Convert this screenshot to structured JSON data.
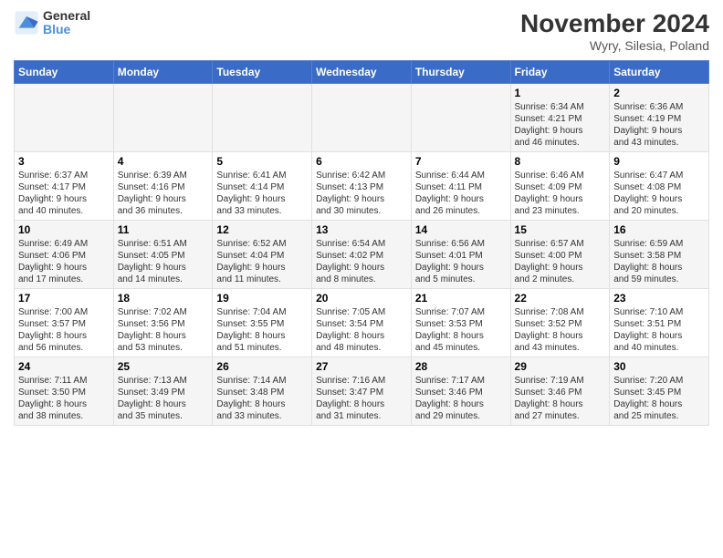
{
  "header": {
    "logo_line1": "General",
    "logo_line2": "Blue",
    "title": "November 2024",
    "subtitle": "Wyry, Silesia, Poland"
  },
  "days_of_week": [
    "Sunday",
    "Monday",
    "Tuesday",
    "Wednesday",
    "Thursday",
    "Friday",
    "Saturday"
  ],
  "weeks": [
    [
      {
        "day": "",
        "info": ""
      },
      {
        "day": "",
        "info": ""
      },
      {
        "day": "",
        "info": ""
      },
      {
        "day": "",
        "info": ""
      },
      {
        "day": "",
        "info": ""
      },
      {
        "day": "1",
        "info": "Sunrise: 6:34 AM\nSunset: 4:21 PM\nDaylight: 9 hours\nand 46 minutes."
      },
      {
        "day": "2",
        "info": "Sunrise: 6:36 AM\nSunset: 4:19 PM\nDaylight: 9 hours\nand 43 minutes."
      }
    ],
    [
      {
        "day": "3",
        "info": "Sunrise: 6:37 AM\nSunset: 4:17 PM\nDaylight: 9 hours\nand 40 minutes."
      },
      {
        "day": "4",
        "info": "Sunrise: 6:39 AM\nSunset: 4:16 PM\nDaylight: 9 hours\nand 36 minutes."
      },
      {
        "day": "5",
        "info": "Sunrise: 6:41 AM\nSunset: 4:14 PM\nDaylight: 9 hours\nand 33 minutes."
      },
      {
        "day": "6",
        "info": "Sunrise: 6:42 AM\nSunset: 4:13 PM\nDaylight: 9 hours\nand 30 minutes."
      },
      {
        "day": "7",
        "info": "Sunrise: 6:44 AM\nSunset: 4:11 PM\nDaylight: 9 hours\nand 26 minutes."
      },
      {
        "day": "8",
        "info": "Sunrise: 6:46 AM\nSunset: 4:09 PM\nDaylight: 9 hours\nand 23 minutes."
      },
      {
        "day": "9",
        "info": "Sunrise: 6:47 AM\nSunset: 4:08 PM\nDaylight: 9 hours\nand 20 minutes."
      }
    ],
    [
      {
        "day": "10",
        "info": "Sunrise: 6:49 AM\nSunset: 4:06 PM\nDaylight: 9 hours\nand 17 minutes."
      },
      {
        "day": "11",
        "info": "Sunrise: 6:51 AM\nSunset: 4:05 PM\nDaylight: 9 hours\nand 14 minutes."
      },
      {
        "day": "12",
        "info": "Sunrise: 6:52 AM\nSunset: 4:04 PM\nDaylight: 9 hours\nand 11 minutes."
      },
      {
        "day": "13",
        "info": "Sunrise: 6:54 AM\nSunset: 4:02 PM\nDaylight: 9 hours\nand 8 minutes."
      },
      {
        "day": "14",
        "info": "Sunrise: 6:56 AM\nSunset: 4:01 PM\nDaylight: 9 hours\nand 5 minutes."
      },
      {
        "day": "15",
        "info": "Sunrise: 6:57 AM\nSunset: 4:00 PM\nDaylight: 9 hours\nand 2 minutes."
      },
      {
        "day": "16",
        "info": "Sunrise: 6:59 AM\nSunset: 3:58 PM\nDaylight: 8 hours\nand 59 minutes."
      }
    ],
    [
      {
        "day": "17",
        "info": "Sunrise: 7:00 AM\nSunset: 3:57 PM\nDaylight: 8 hours\nand 56 minutes."
      },
      {
        "day": "18",
        "info": "Sunrise: 7:02 AM\nSunset: 3:56 PM\nDaylight: 8 hours\nand 53 minutes."
      },
      {
        "day": "19",
        "info": "Sunrise: 7:04 AM\nSunset: 3:55 PM\nDaylight: 8 hours\nand 51 minutes."
      },
      {
        "day": "20",
        "info": "Sunrise: 7:05 AM\nSunset: 3:54 PM\nDaylight: 8 hours\nand 48 minutes."
      },
      {
        "day": "21",
        "info": "Sunrise: 7:07 AM\nSunset: 3:53 PM\nDaylight: 8 hours\nand 45 minutes."
      },
      {
        "day": "22",
        "info": "Sunrise: 7:08 AM\nSunset: 3:52 PM\nDaylight: 8 hours\nand 43 minutes."
      },
      {
        "day": "23",
        "info": "Sunrise: 7:10 AM\nSunset: 3:51 PM\nDaylight: 8 hours\nand 40 minutes."
      }
    ],
    [
      {
        "day": "24",
        "info": "Sunrise: 7:11 AM\nSunset: 3:50 PM\nDaylight: 8 hours\nand 38 minutes."
      },
      {
        "day": "25",
        "info": "Sunrise: 7:13 AM\nSunset: 3:49 PM\nDaylight: 8 hours\nand 35 minutes."
      },
      {
        "day": "26",
        "info": "Sunrise: 7:14 AM\nSunset: 3:48 PM\nDaylight: 8 hours\nand 33 minutes."
      },
      {
        "day": "27",
        "info": "Sunrise: 7:16 AM\nSunset: 3:47 PM\nDaylight: 8 hours\nand 31 minutes."
      },
      {
        "day": "28",
        "info": "Sunrise: 7:17 AM\nSunset: 3:46 PM\nDaylight: 8 hours\nand 29 minutes."
      },
      {
        "day": "29",
        "info": "Sunrise: 7:19 AM\nSunset: 3:46 PM\nDaylight: 8 hours\nand 27 minutes."
      },
      {
        "day": "30",
        "info": "Sunrise: 7:20 AM\nSunset: 3:45 PM\nDaylight: 8 hours\nand 25 minutes."
      }
    ]
  ]
}
